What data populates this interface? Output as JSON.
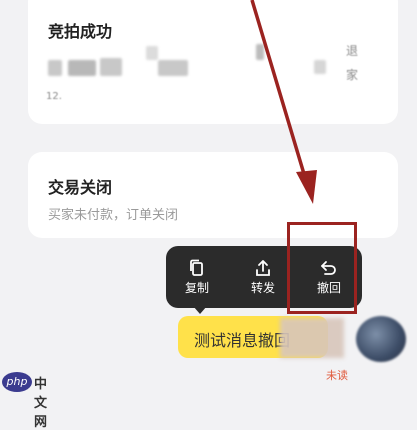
{
  "cards": [
    {
      "title": "竞拍成功",
      "blurred_lines": [
        "退",
        "家",
        "12."
      ]
    },
    {
      "title": "交易关闭",
      "subtitle": "买家未付款，订单关闭"
    }
  ],
  "context_menu": {
    "items": [
      {
        "label": "复制",
        "icon": "copy-icon"
      },
      {
        "label": "转发",
        "icon": "share-icon"
      },
      {
        "label": "撤回",
        "icon": "undo-icon"
      }
    ]
  },
  "message": {
    "text": "测试消息撤回",
    "read_status": "未读",
    "bubble_color": "#ffe14a"
  },
  "annotation": {
    "color": "#9b2320"
  },
  "watermark": {
    "text": "中文网",
    "logo": "php"
  }
}
